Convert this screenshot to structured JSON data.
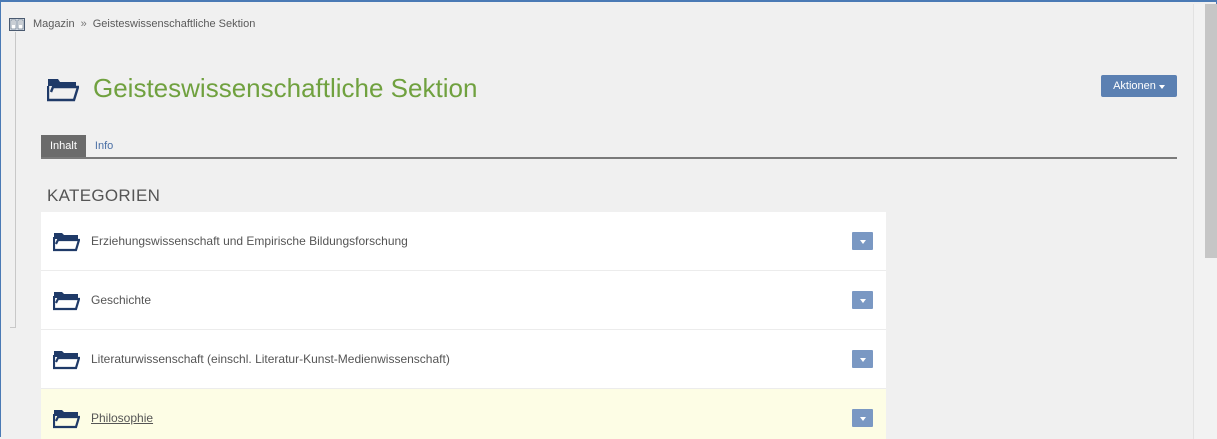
{
  "breadcrumb": {
    "items": [
      "Magazin",
      "Geisteswissenschaftliche Sektion"
    ],
    "separator": "»"
  },
  "header": {
    "title": "Geisteswissenschaftliche Sektion",
    "icon": "folder-open-icon",
    "title_color": "#70a13f"
  },
  "actions": {
    "label": "Aktionen"
  },
  "tabs": [
    {
      "label": "Inhalt",
      "active": true
    },
    {
      "label": "Info",
      "active": false
    }
  ],
  "section": {
    "heading": "KATEGORIEN"
  },
  "categories": [
    {
      "label": "Erziehungswissenschaft und Empirische Bildungsforschung",
      "highlighted": false
    },
    {
      "label": "Geschichte",
      "highlighted": false
    },
    {
      "label": "Literaturwissenschaft (einschl. Literatur-Kunst-Medienwissenschaft)",
      "highlighted": false
    },
    {
      "label": "Philosophie",
      "highlighted": true
    }
  ],
  "colors": {
    "accent": "#5b80b2",
    "folder": "#1f3a68",
    "highlight_row": "#fdfde5",
    "frame_border": "#4a7ab5"
  }
}
